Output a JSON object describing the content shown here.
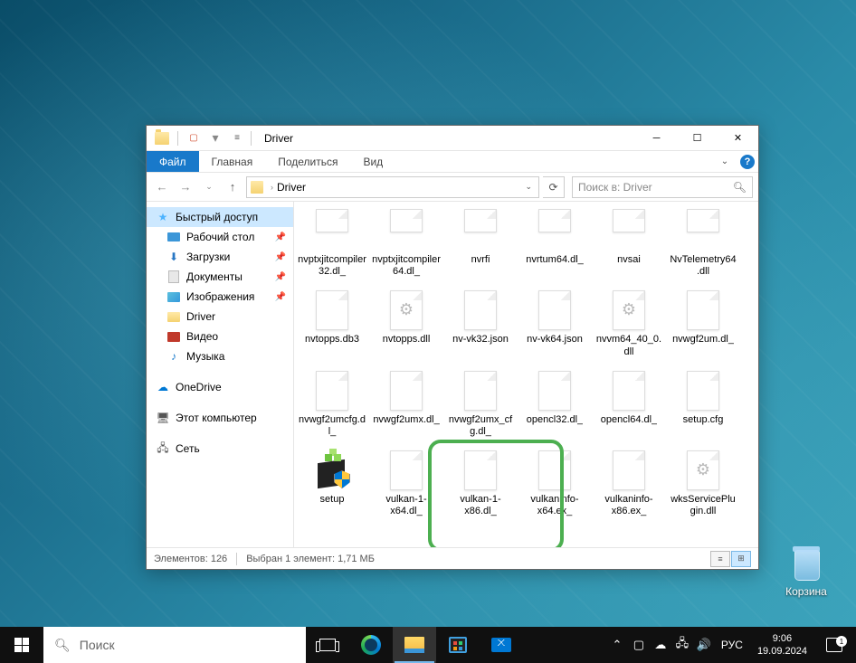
{
  "window": {
    "title": "Driver",
    "tabs": {
      "file": "Файл",
      "home": "Главная",
      "share": "Поделиться",
      "view": "Вид"
    },
    "breadcrumb": "Driver",
    "search_placeholder": "Поиск в: Driver"
  },
  "sidebar": {
    "quick_access": "Быстрый доступ",
    "items": [
      {
        "label": "Рабочий стол",
        "pinned": true
      },
      {
        "label": "Загрузки",
        "pinned": true
      },
      {
        "label": "Документы",
        "pinned": true
      },
      {
        "label": "Изображения",
        "pinned": true
      },
      {
        "label": "Driver",
        "pinned": false
      },
      {
        "label": "Видео",
        "pinned": false
      },
      {
        "label": "Музыка",
        "pinned": false
      }
    ],
    "onedrive": "OneDrive",
    "this_pc": "Этот компьютер",
    "network": "Сеть"
  },
  "files": [
    {
      "name": "nvptxjitcompiler32.dl_",
      "type": "half"
    },
    {
      "name": "nvptxjitcompiler64.dl_",
      "type": "half"
    },
    {
      "name": "nvrfi",
      "type": "half"
    },
    {
      "name": "nvrtum64.dl_",
      "type": "half"
    },
    {
      "name": "nvsai",
      "type": "half"
    },
    {
      "name": "NvTelemetry64.dll",
      "type": "half"
    },
    {
      "name": "nvtopps.db3",
      "type": "file"
    },
    {
      "name": "nvtopps.dll",
      "type": "gear"
    },
    {
      "name": "nv-vk32.json",
      "type": "file"
    },
    {
      "name": "nv-vk64.json",
      "type": "file"
    },
    {
      "name": "nvvm64_40_0.dll",
      "type": "gear"
    },
    {
      "name": "nvwgf2um.dl_",
      "type": "file"
    },
    {
      "name": "nvwgf2umcfg.dl_",
      "type": "file"
    },
    {
      "name": "nvwgf2umx.dl_",
      "type": "file"
    },
    {
      "name": "nvwgf2umx_cfg.dl_",
      "type": "file"
    },
    {
      "name": "opencl32.dl_",
      "type": "file"
    },
    {
      "name": "opencl64.dl_",
      "type": "file"
    },
    {
      "name": "setup.cfg",
      "type": "file"
    },
    {
      "name": "setup",
      "type": "setup"
    },
    {
      "name": "vulkan-1-x64.dl_",
      "type": "file"
    },
    {
      "name": "vulkan-1-x86.dl_",
      "type": "file"
    },
    {
      "name": "vulkaninfo-x64.ex_",
      "type": "file"
    },
    {
      "name": "vulkaninfo-x86.ex_",
      "type": "file"
    },
    {
      "name": "wksServicePlugin.dll",
      "type": "gear"
    }
  ],
  "status": {
    "count_label": "Элементов: 126",
    "selection_label": "Выбран 1 элемент: 1,71 МБ"
  },
  "desktop": {
    "recycle_bin": "Корзина"
  },
  "taskbar": {
    "search_placeholder": "Поиск",
    "lang": "РУС",
    "time": "9:06",
    "date": "19.09.2024",
    "notif_count": "1"
  }
}
